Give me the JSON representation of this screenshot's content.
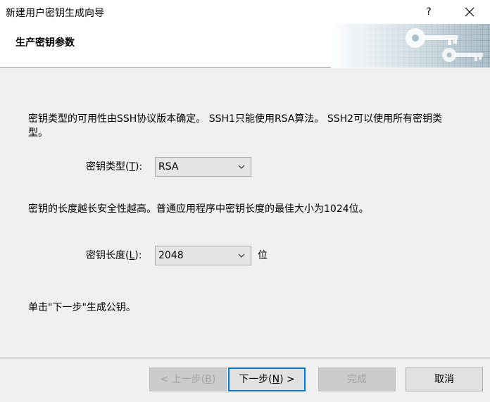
{
  "window": {
    "title": "新建用户密钥生成向导",
    "help_glyph": "?"
  },
  "header": {
    "title": "生产密钥参数"
  },
  "content": {
    "intro_line1": "密钥类型的可用性由SSH协议版本确定。 SSH1只能使用RSA算法。 SSH2可以使用所有密钥类",
    "intro_line2": "型。",
    "key_type": {
      "label_prefix": "密钥类型(",
      "label_accel": "T",
      "label_suffix": "):",
      "value": "RSA"
    },
    "length_note": "密钥的长度越长安全性越高。普通应用程序中密钥长度的最佳大小为1024位。",
    "key_length": {
      "label_prefix": "密钥长度(",
      "label_accel": "L",
      "label_suffix": "):",
      "value": "2048",
      "unit": "位"
    },
    "next_hint": "单击\"下一步\"生成公钥。"
  },
  "footer": {
    "back": {
      "prefix": "< 上一步(",
      "accel": "B",
      "suffix": ")"
    },
    "next": {
      "prefix": "下一步(",
      "accel": "N",
      "suffix": ") >"
    },
    "finish": "完成",
    "cancel": "取消"
  },
  "colors": {
    "panel": "#f0f0f0",
    "focus_border": "#0078d7",
    "header_art": "#9fb8c6"
  }
}
